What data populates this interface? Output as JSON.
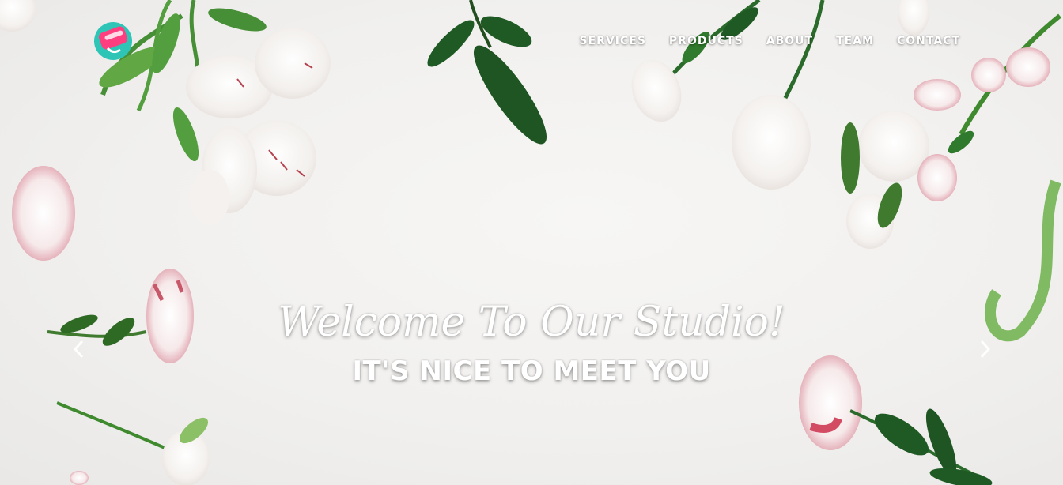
{
  "brand": {
    "logo_icon": "paint-roller-logo-icon",
    "colors": {
      "logo_teal": "#2ec4b6",
      "logo_pink": "#ff3d7f"
    }
  },
  "nav": {
    "items": [
      {
        "label": "SERVICES"
      },
      {
        "label": "PRODUCTS"
      },
      {
        "label": "ABOUT"
      },
      {
        "label": "TEAM"
      },
      {
        "label": "CONTACT"
      }
    ]
  },
  "hero": {
    "welcome": "Welcome To Our Studio!",
    "subheading": "IT'S NICE TO MEET YOU",
    "prev_icon": "chevron-left-icon",
    "next_icon": "chevron-right-icon"
  }
}
